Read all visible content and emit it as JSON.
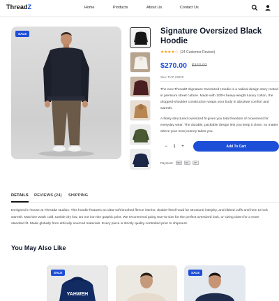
{
  "header": {
    "logo_text": "Thread",
    "logo_accent": "Z",
    "logo_mark": "♩",
    "nav": [
      "Home",
      "Products",
      "About Us",
      "Contact Us"
    ]
  },
  "product": {
    "sale_label": "SALE",
    "title": "Signature Oversized Black Hoodie",
    "rating_stars": "★★★★☆",
    "rating_value": 4.5,
    "reviews_text": "(24 Customer Review)",
    "price": "$270.00",
    "old_price": "$340.00",
    "sku": "Sku: TKZ-23820",
    "description_1": "The new ThreadZ Signature Oversized Hoodie is a radical design story rooted\nin premium street culture. Made with 100% heavy-weight luxury cotton, the\ndropped-shoulder construction wraps your body in absolute comfort and\nwarmth.",
    "description_2": "A finely structured oversized fit gives you total freedom of movement for\neveryday wear. The durable, packable design lets you keep it close, no matter\nwhere your next journey takes you.",
    "quantity": "1",
    "minus": "−",
    "plus": "+",
    "add_to_cart": "Add To Cart",
    "payment_label": "Payment:",
    "payment_cards": [
      "VISA",
      "MC",
      "PP"
    ]
  },
  "tabs": {
    "details": "DETAILS",
    "reviews": "REVIEWS (24)",
    "shipping": "SHIPPING",
    "details_body": "Designed in-house at ThreadZ studios. This hoodie features an ultra-soft brushed fleece interior, double-lined hood for structural integrity, and ribbed cuffs and hem to lock\nwarmth. Machine wash cold, tumble dry low. Do not iron the graphic print. We recommend going true-to-size for the perfect oversized look, or sizing down for a more\nstandard fit. Made globally from ethically sourced materials. Every piece is strictly quality-controlled prior to shipment."
  },
  "related": {
    "title": "You May Also Like",
    "sale_label": "SALE",
    "card1_print": "YAHWEH"
  },
  "colors": {
    "accent": "#1d4ed8",
    "star": "#f59e0b"
  }
}
